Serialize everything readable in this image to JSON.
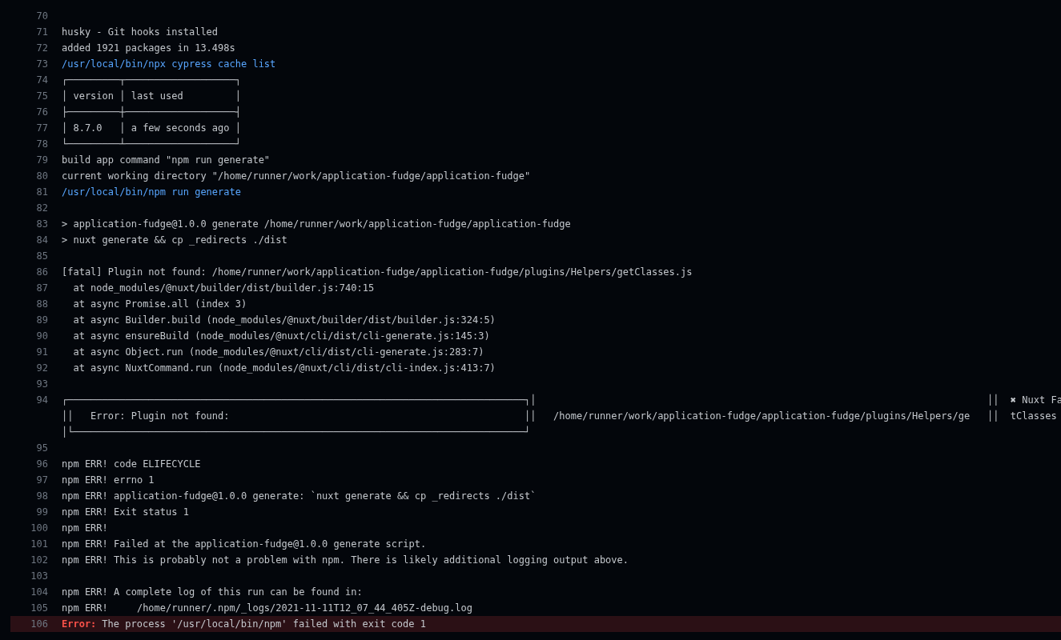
{
  "log": {
    "lines": [
      {
        "number": "70",
        "kind": "plain"
      },
      {
        "number": "71",
        "kind": "plain",
        "text": "husky - Git hooks installed"
      },
      {
        "number": "72",
        "kind": "plain",
        "text": "added 1921 packages in 13.498s"
      },
      {
        "number": "73",
        "kind": "command",
        "text": "/usr/local/bin/npx cypress cache list"
      },
      {
        "number": "74",
        "kind": "plain",
        "text": "┌─────────┬───────────────────┐"
      },
      {
        "number": "75",
        "kind": "plain",
        "text": "│ version │ last used         │"
      },
      {
        "number": "76",
        "kind": "plain",
        "text": "├─────────┼───────────────────┤"
      },
      {
        "number": "77",
        "kind": "plain",
        "text": "│ 8.7.0   │ a few seconds ago │"
      },
      {
        "number": "78",
        "kind": "plain",
        "text": "└─────────┴───────────────────┘"
      },
      {
        "number": "79",
        "kind": "plain",
        "text": "build app command \"npm run generate\""
      },
      {
        "number": "80",
        "kind": "plain",
        "text": "current working directory \"/home/runner/work/application-fudge/application-fudge\""
      },
      {
        "number": "81",
        "kind": "command",
        "text": "/usr/local/bin/npm run generate"
      },
      {
        "number": "82",
        "kind": "plain"
      },
      {
        "number": "83",
        "kind": "plain",
        "text": "> application-fudge@1.0.0 generate /home/runner/work/application-fudge/application-fudge"
      },
      {
        "number": "84",
        "kind": "plain",
        "text": "> nuxt generate && cp _redirects ./dist"
      },
      {
        "number": "85",
        "kind": "plain"
      },
      {
        "number": "86",
        "kind": "plain",
        "text": "[fatal] Plugin not found: /home/runner/work/application-fudge/application-fudge/plugins/Helpers/getClasses.js"
      },
      {
        "number": "87",
        "kind": "plain",
        "text": "  at node_modules/@nuxt/builder/dist/builder.js:740:15"
      },
      {
        "number": "88",
        "kind": "plain",
        "text": "  at async Promise.all (index 3)"
      },
      {
        "number": "89",
        "kind": "plain",
        "text": "  at async Builder.build (node_modules/@nuxt/builder/dist/builder.js:324:5)"
      },
      {
        "number": "90",
        "kind": "plain",
        "text": "  at async ensureBuild (node_modules/@nuxt/cli/dist/cli-generate.js:145:3)"
      },
      {
        "number": "91",
        "kind": "plain",
        "text": "  at async Object.run (node_modules/@nuxt/cli/dist/cli-generate.js:283:7)"
      },
      {
        "number": "92",
        "kind": "plain",
        "text": "  at async NuxtCommand.run (node_modules/@nuxt/cli/dist/cli-index.js:413:7)"
      },
      {
        "number": "93",
        "kind": "plain"
      },
      {
        "number": "94",
        "kind": "plain",
        "text": "┌───────────────────────────────────────────────────────────────────────────────┐│                                                                              ││  ✖ Nuxt Fa\n││   Error: Plugin not found:                                                   ││   /home/runner/work/application-fudge/application-fudge/plugins/Helpers/ge   ││  tClasses\n│└──────────────────────────────────────────────────────────────────────────────┘"
      },
      {
        "number": "95",
        "kind": "plain"
      },
      {
        "number": "96",
        "kind": "plain",
        "text": "npm ERR! code ELIFECYCLE"
      },
      {
        "number": "97",
        "kind": "plain",
        "text": "npm ERR! errno 1"
      },
      {
        "number": "98",
        "kind": "plain",
        "text": "npm ERR! application-fudge@1.0.0 generate: `nuxt generate && cp _redirects ./dist`"
      },
      {
        "number": "99",
        "kind": "plain",
        "text": "npm ERR! Exit status 1"
      },
      {
        "number": "100",
        "kind": "plain",
        "text": "npm ERR!"
      },
      {
        "number": "101",
        "kind": "plain",
        "text": "npm ERR! Failed at the application-fudge@1.0.0 generate script."
      },
      {
        "number": "102",
        "kind": "plain",
        "text": "npm ERR! This is probably not a problem with npm. There is likely additional logging output above."
      },
      {
        "number": "103",
        "kind": "plain"
      },
      {
        "number": "104",
        "kind": "plain",
        "text": "npm ERR! A complete log of this run can be found in:"
      },
      {
        "number": "105",
        "kind": "plain",
        "text": "npm ERR!     /home/runner/.npm/_logs/2021-11-11T12_07_44_405Z-debug.log"
      },
      {
        "number": "106",
        "kind": "error",
        "prefix": "Error:",
        "text": "The process '/usr/local/bin/npm' failed with exit code 1"
      }
    ]
  }
}
